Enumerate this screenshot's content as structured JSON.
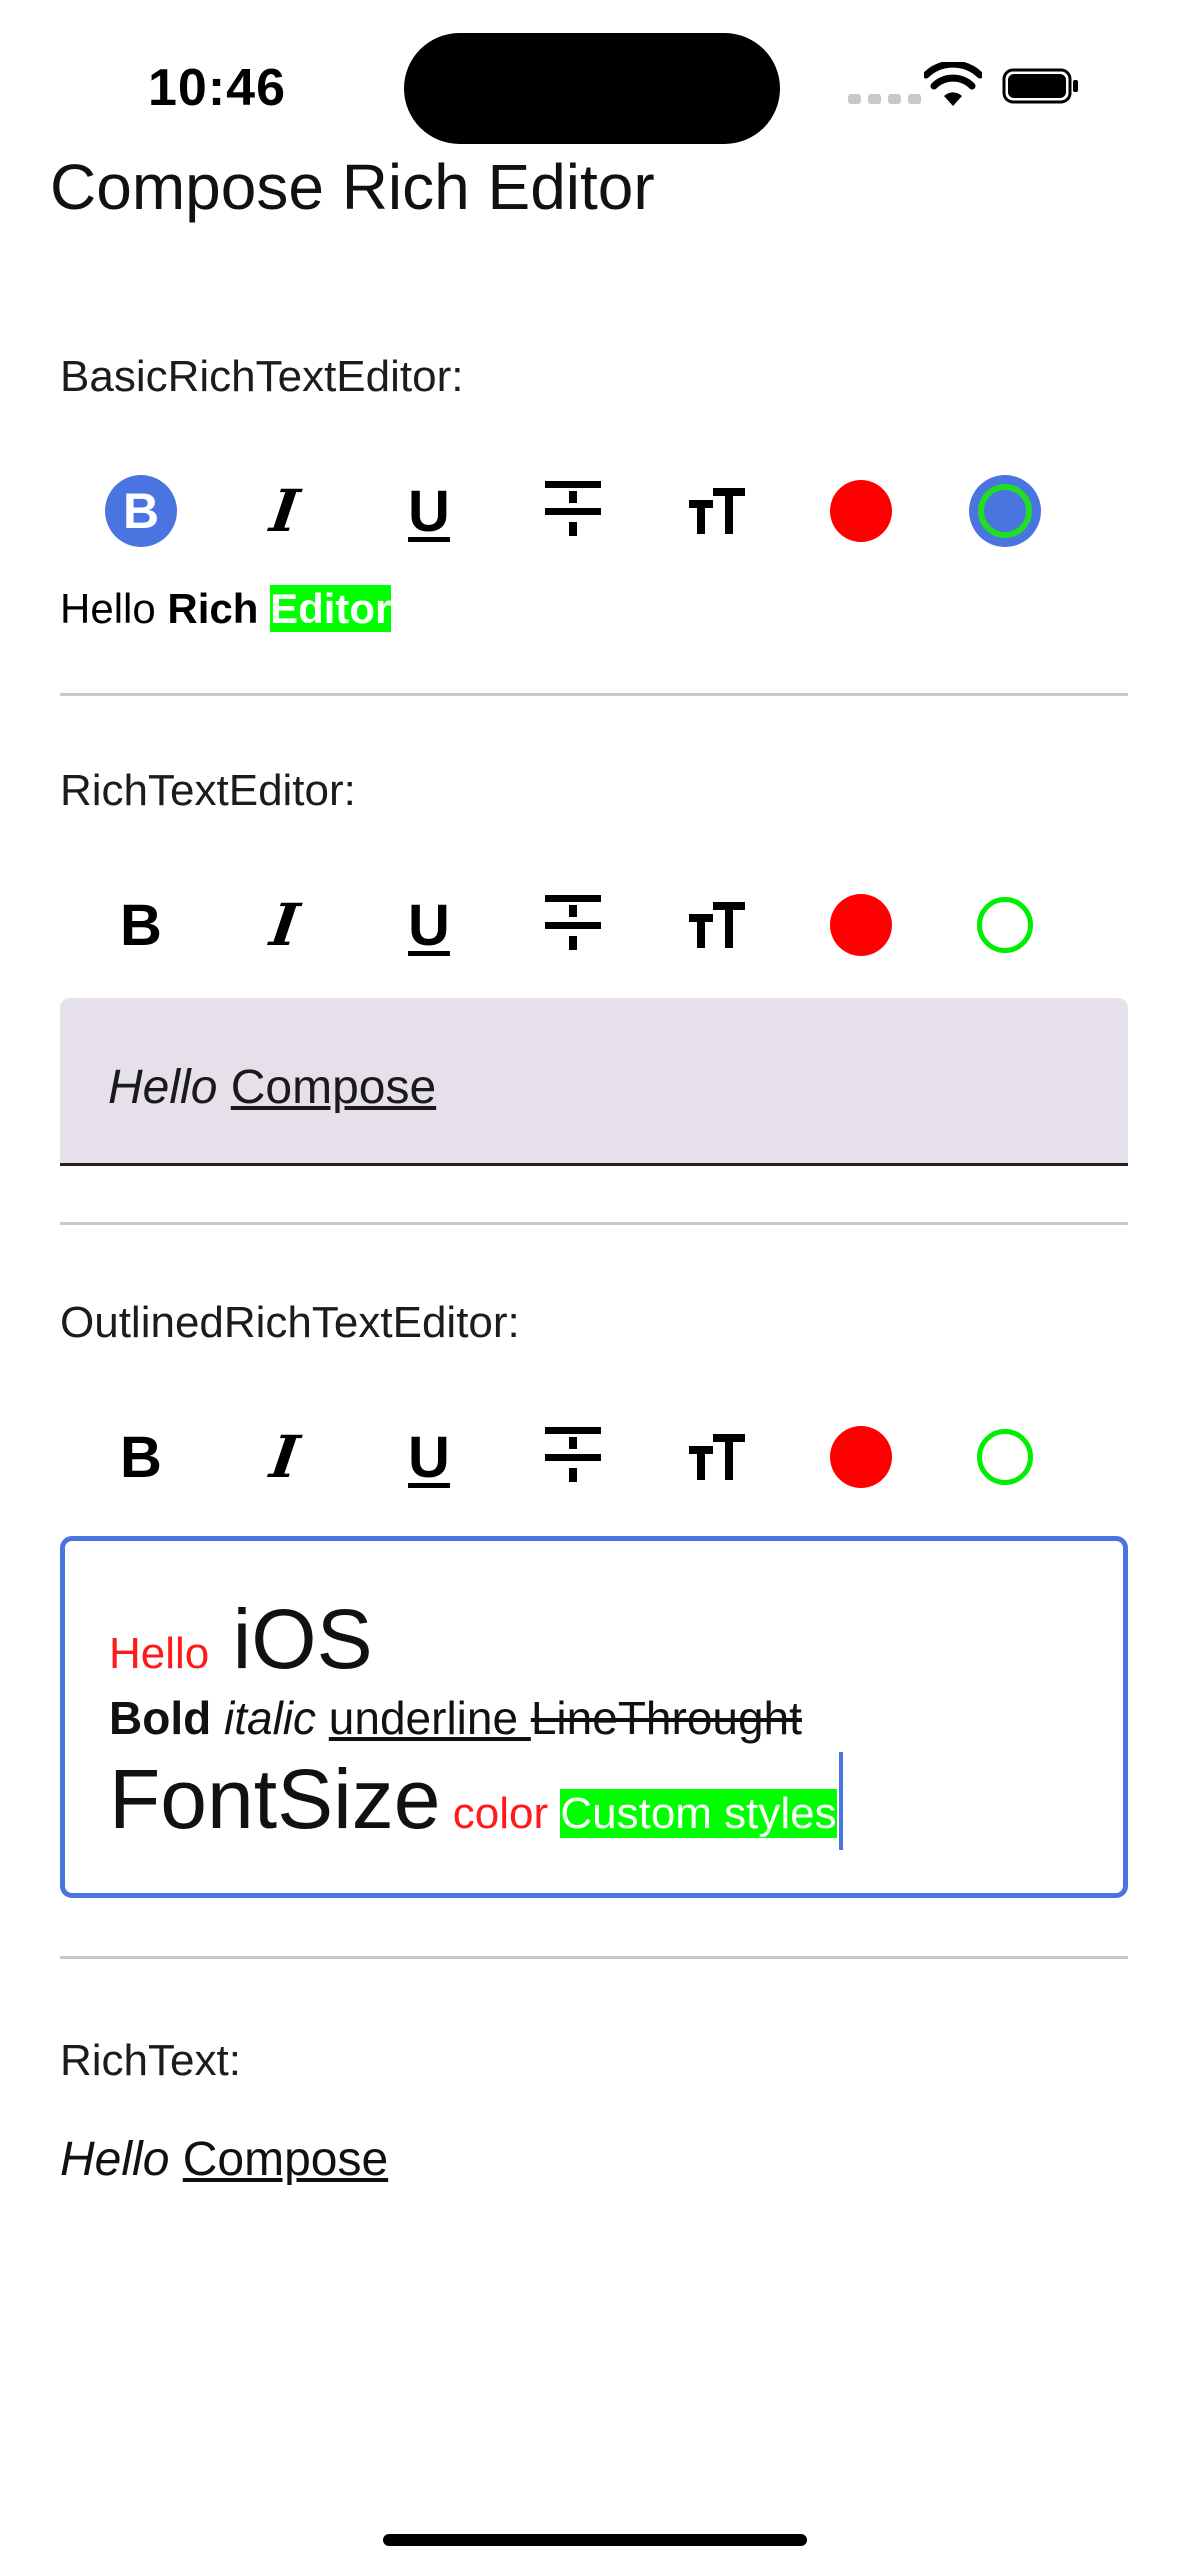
{
  "status_bar": {
    "time": "10:46"
  },
  "app": {
    "title": "Compose Rich Editor"
  },
  "toolbar": {
    "bold": "B",
    "italic": "I",
    "underline": "U",
    "icons": [
      "bold-icon",
      "italic-icon",
      "underline-icon",
      "strikethrough-icon",
      "font-size-icon",
      "red-color-icon",
      "green-highlight-icon"
    ]
  },
  "colors": {
    "accent": "#4a74e0",
    "red": "#ff0000",
    "green": "#00ff00",
    "filled_bg": "#e6e0eb",
    "divider": "#c9c7d4"
  },
  "basic": {
    "label": "BasicRichTextEditor:",
    "text": {
      "hello": "Hello ",
      "rich": "Rich",
      "space": " ",
      "editor": "Editor"
    }
  },
  "rich": {
    "label": "RichTextEditor:",
    "text": {
      "hello": "Hello",
      "space": " ",
      "compose": "Compose"
    }
  },
  "outlined": {
    "label": "OutlinedRichTextEditor:",
    "line1": {
      "hello": "Hello",
      "ios": "iOS"
    },
    "line2": {
      "bold": "Bold",
      "italic": "italic",
      "underline": "underline ",
      "strike": "LineThrought"
    },
    "line3": {
      "fontsize": "FontSize",
      "color": "color",
      "custom": "Custom styles"
    }
  },
  "richtext": {
    "label": "RichText:",
    "text": {
      "hello": "Hello",
      "space": " ",
      "compose": "Compose"
    }
  }
}
